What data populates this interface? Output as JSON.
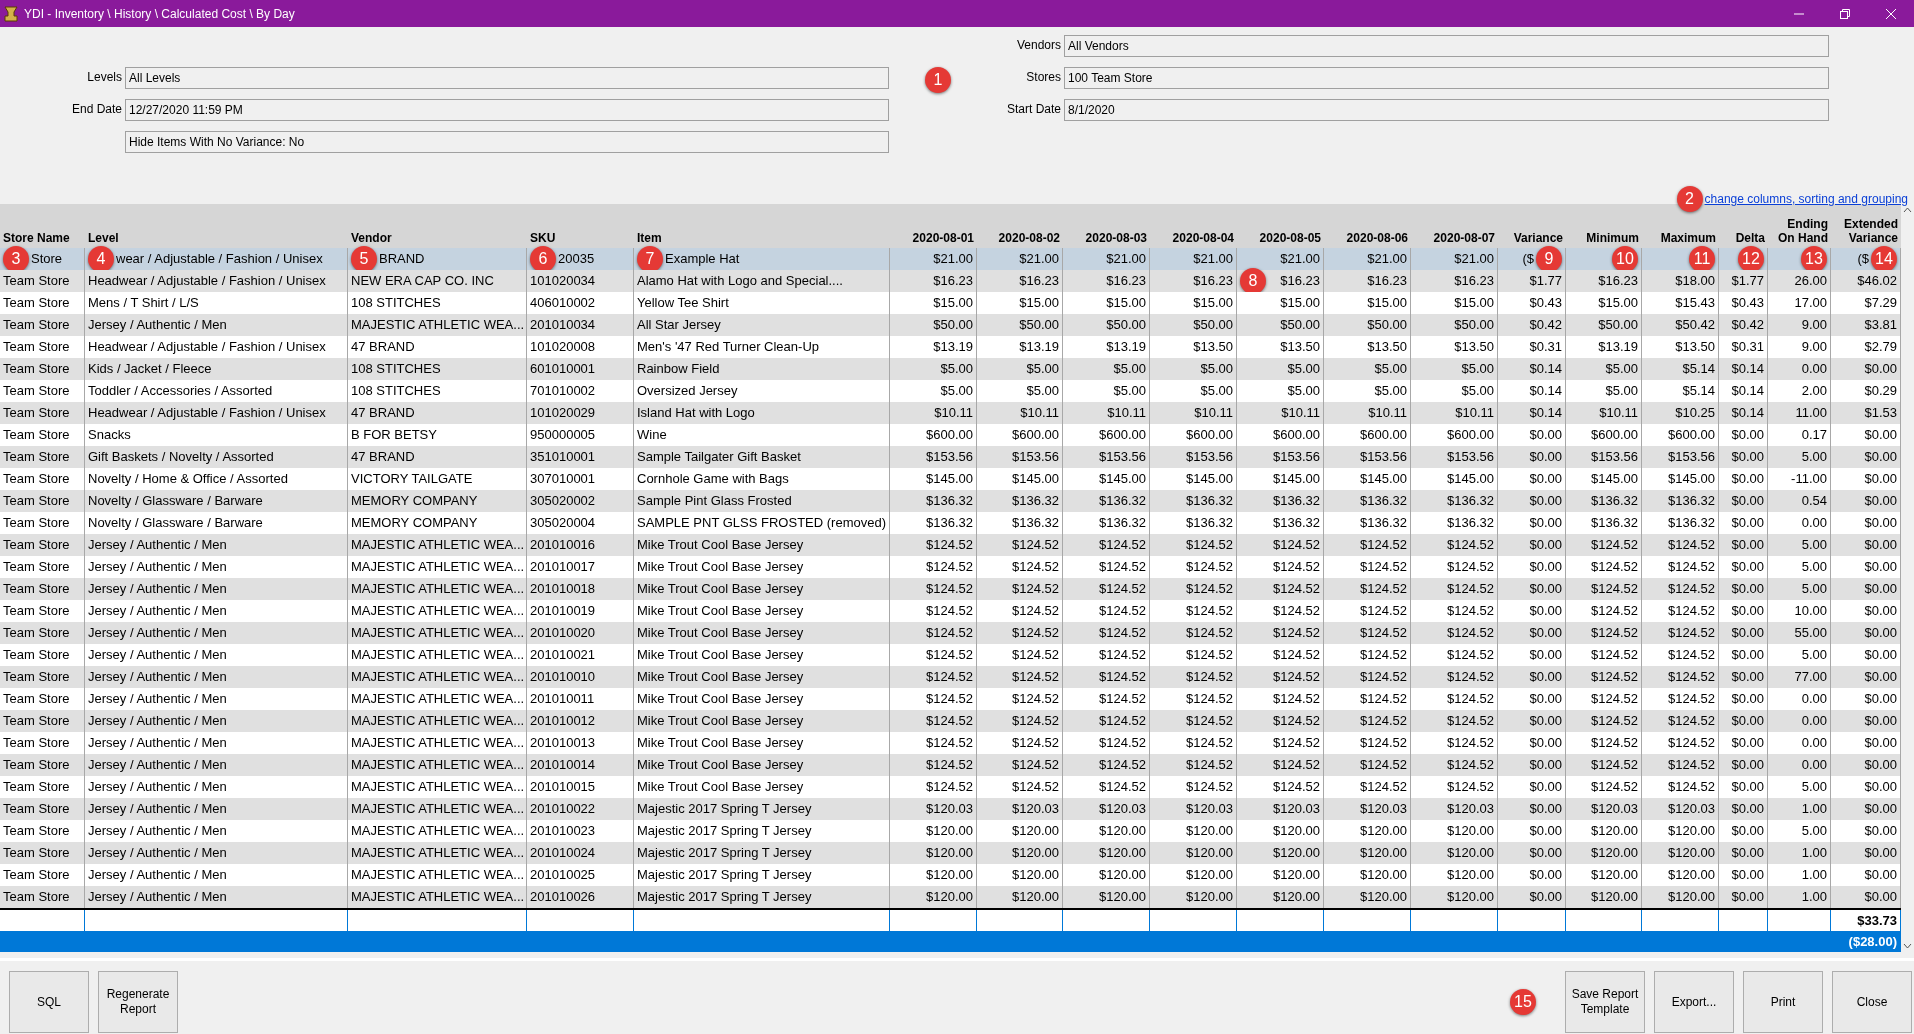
{
  "window": {
    "title": "YDI - Inventory \\ History \\ Calculated Cost \\ By Day"
  },
  "filters_callout": "1",
  "filters": {
    "left": [
      {
        "label": "Levels",
        "value": "All Levels"
      },
      {
        "label": "End Date",
        "value": "12/27/2020 11:59 PM"
      },
      {
        "value": "Hide Items With No Variance: No"
      }
    ],
    "right": [
      {
        "label": "Vendors",
        "value": "All Vendors"
      },
      {
        "label": "Stores",
        "value": "100 Team Store"
      },
      {
        "label": "Start Date",
        "value": "8/1/2020"
      }
    ]
  },
  "columns_link": {
    "text": "change columns, sorting and grouping",
    "callout": "2"
  },
  "table": {
    "columns": [
      "Store Name",
      "Level",
      "Vendor",
      "SKU",
      "Item",
      "2020-08-01",
      "2020-08-02",
      "2020-08-03",
      "2020-08-04",
      "2020-08-05",
      "2020-08-06",
      "2020-08-07",
      "Variance",
      "Minimum",
      "Maximum",
      "Delta",
      "Ending On Hand",
      "Extended Variance"
    ],
    "rows": [
      {
        "selected": true,
        "cells": [
          {
            "text": "Store",
            "callout": "3"
          },
          {
            "text": "wear / Adjustable / Fashion / Unisex",
            "callout": "4"
          },
          {
            "text": "BRAND",
            "callout": "5"
          },
          {
            "text": "20035",
            "callout": "6"
          },
          {
            "text": "Example Hat",
            "callout": "7"
          },
          "$21.00",
          "$21.00",
          "$21.00",
          "$21.00",
          "$21.00",
          "$21.00",
          "$21.00",
          {
            "text": "($",
            "callout": "9"
          },
          {
            "callout": "10"
          },
          {
            "callout": "11"
          },
          {
            "callout": "12"
          },
          {
            "callout": "13"
          },
          {
            "text": "($",
            "callout": "14"
          }
        ]
      },
      {
        "selected": false,
        "cells": [
          "Team Store",
          "Headwear / Adjustable / Fashion / Unisex",
          "NEW ERA CAP CO. INC",
          "101020034",
          "Alamo Hat with Logo and Special....",
          "$16.23",
          "$16.23",
          "$16.23",
          "$16.23",
          {
            "text": "$16.23",
            "callout": "8"
          },
          "$16.23",
          "$16.23",
          "$1.77",
          "$16.23",
          "$18.00",
          "$1.77",
          "26.00",
          "$46.02"
        ]
      },
      {
        "selected": false,
        "cells": [
          "Team Store",
          "Mens / T Shirt / L/S",
          "108 STITCHES",
          "406010002",
          "Yellow Tee Shirt",
          "$15.00",
          "$15.00",
          "$15.00",
          "$15.00",
          "$15.00",
          "$15.00",
          "$15.00",
          "$0.43",
          "$15.00",
          "$15.43",
          "$0.43",
          "17.00",
          "$7.29"
        ]
      },
      {
        "selected": false,
        "cells": [
          "Team Store",
          "Jersey / Authentic / Men",
          "MAJESTIC ATHLETIC WEA...",
          "201010034",
          "All Star Jersey",
          "$50.00",
          "$50.00",
          "$50.00",
          "$50.00",
          "$50.00",
          "$50.00",
          "$50.00",
          "$0.42",
          "$50.00",
          "$50.42",
          "$0.42",
          "9.00",
          "$3.81"
        ]
      },
      {
        "selected": false,
        "cells": [
          "Team Store",
          "Headwear / Adjustable / Fashion / Unisex",
          "47 BRAND",
          "101020008",
          "Men's '47 Red Turner Clean-Up",
          "$13.19",
          "$13.19",
          "$13.19",
          "$13.50",
          "$13.50",
          "$13.50",
          "$13.50",
          "$0.31",
          "$13.19",
          "$13.50",
          "$0.31",
          "9.00",
          "$2.79"
        ]
      },
      {
        "selected": false,
        "cells": [
          "Team Store",
          "Kids / Jacket / Fleece",
          "108 STITCHES",
          "601010001",
          "Rainbow Field",
          "$5.00",
          "$5.00",
          "$5.00",
          "$5.00",
          "$5.00",
          "$5.00",
          "$5.00",
          "$0.14",
          "$5.00",
          "$5.14",
          "$0.14",
          "0.00",
          "$0.00"
        ]
      },
      {
        "selected": false,
        "cells": [
          "Team Store",
          "Toddler / Accessories / Assorted",
          "108 STITCHES",
          "701010002",
          "Oversized Jersey",
          "$5.00",
          "$5.00",
          "$5.00",
          "$5.00",
          "$5.00",
          "$5.00",
          "$5.00",
          "$0.14",
          "$5.00",
          "$5.14",
          "$0.14",
          "2.00",
          "$0.29"
        ]
      },
      {
        "selected": false,
        "cells": [
          "Team Store",
          "Headwear / Adjustable / Fashion / Unisex",
          "47 BRAND",
          "101020029",
          "Island Hat with Logo",
          "$10.11",
          "$10.11",
          "$10.11",
          "$10.11",
          "$10.11",
          "$10.11",
          "$10.11",
          "$0.14",
          "$10.11",
          "$10.25",
          "$0.14",
          "11.00",
          "$1.53"
        ]
      },
      {
        "selected": false,
        "cells": [
          "Team Store",
          "Snacks",
          "B FOR BETSY",
          "950000005",
          "Wine",
          "$600.00",
          "$600.00",
          "$600.00",
          "$600.00",
          "$600.00",
          "$600.00",
          "$600.00",
          "$0.00",
          "$600.00",
          "$600.00",
          "$0.00",
          "0.17",
          "$0.00"
        ]
      },
      {
        "selected": false,
        "cells": [
          "Team Store",
          "Gift Baskets / Novelty / Assorted",
          "47 BRAND",
          "351010001",
          "Sample Tailgater Gift Basket",
          "$153.56",
          "$153.56",
          "$153.56",
          "$153.56",
          "$153.56",
          "$153.56",
          "$153.56",
          "$0.00",
          "$153.56",
          "$153.56",
          "$0.00",
          "5.00",
          "$0.00"
        ]
      },
      {
        "selected": false,
        "cells": [
          "Team Store",
          "Novelty / Home & Office / Assorted",
          "VICTORY TAILGATE",
          "307010001",
          "Cornhole Game with Bags",
          "$145.00",
          "$145.00",
          "$145.00",
          "$145.00",
          "$145.00",
          "$145.00",
          "$145.00",
          "$0.00",
          "$145.00",
          "$145.00",
          "$0.00",
          "-11.00",
          "$0.00"
        ]
      },
      {
        "selected": false,
        "cells": [
          "Team Store",
          "Novelty / Glassware / Barware",
          "MEMORY COMPANY",
          "305020002",
          "Sample Pint Glass Frosted",
          "$136.32",
          "$136.32",
          "$136.32",
          "$136.32",
          "$136.32",
          "$136.32",
          "$136.32",
          "$0.00",
          "$136.32",
          "$136.32",
          "$0.00",
          "0.54",
          "$0.00"
        ]
      },
      {
        "selected": false,
        "cells": [
          "Team Store",
          "Novelty / Glassware / Barware",
          "MEMORY COMPANY",
          "305020004",
          "SAMPLE PNT GLSS FROSTED (removed)",
          "$136.32",
          "$136.32",
          "$136.32",
          "$136.32",
          "$136.32",
          "$136.32",
          "$136.32",
          "$0.00",
          "$136.32",
          "$136.32",
          "$0.00",
          "0.00",
          "$0.00"
        ]
      },
      {
        "selected": false,
        "cells": [
          "Team Store",
          "Jersey / Authentic / Men",
          "MAJESTIC ATHLETIC WEA...",
          "201010016",
          "Mike Trout Cool Base Jersey",
          "$124.52",
          "$124.52",
          "$124.52",
          "$124.52",
          "$124.52",
          "$124.52",
          "$124.52",
          "$0.00",
          "$124.52",
          "$124.52",
          "$0.00",
          "5.00",
          "$0.00"
        ]
      },
      {
        "selected": false,
        "cells": [
          "Team Store",
          "Jersey / Authentic / Men",
          "MAJESTIC ATHLETIC WEA...",
          "201010017",
          "Mike Trout Cool Base Jersey",
          "$124.52",
          "$124.52",
          "$124.52",
          "$124.52",
          "$124.52",
          "$124.52",
          "$124.52",
          "$0.00",
          "$124.52",
          "$124.52",
          "$0.00",
          "5.00",
          "$0.00"
        ]
      },
      {
        "selected": false,
        "cells": [
          "Team Store",
          "Jersey / Authentic / Men",
          "MAJESTIC ATHLETIC WEA...",
          "201010018",
          "Mike Trout Cool Base Jersey",
          "$124.52",
          "$124.52",
          "$124.52",
          "$124.52",
          "$124.52",
          "$124.52",
          "$124.52",
          "$0.00",
          "$124.52",
          "$124.52",
          "$0.00",
          "5.00",
          "$0.00"
        ]
      },
      {
        "selected": false,
        "cells": [
          "Team Store",
          "Jersey / Authentic / Men",
          "MAJESTIC ATHLETIC WEA...",
          "201010019",
          "Mike Trout Cool Base Jersey",
          "$124.52",
          "$124.52",
          "$124.52",
          "$124.52",
          "$124.52",
          "$124.52",
          "$124.52",
          "$0.00",
          "$124.52",
          "$124.52",
          "$0.00",
          "10.00",
          "$0.00"
        ]
      },
      {
        "selected": false,
        "cells": [
          "Team Store",
          "Jersey / Authentic / Men",
          "MAJESTIC ATHLETIC WEA...",
          "201010020",
          "Mike Trout Cool Base Jersey",
          "$124.52",
          "$124.52",
          "$124.52",
          "$124.52",
          "$124.52",
          "$124.52",
          "$124.52",
          "$0.00",
          "$124.52",
          "$124.52",
          "$0.00",
          "55.00",
          "$0.00"
        ]
      },
      {
        "selected": false,
        "cells": [
          "Team Store",
          "Jersey / Authentic / Men",
          "MAJESTIC ATHLETIC WEA...",
          "201010021",
          "Mike Trout Cool Base Jersey",
          "$124.52",
          "$124.52",
          "$124.52",
          "$124.52",
          "$124.52",
          "$124.52",
          "$124.52",
          "$0.00",
          "$124.52",
          "$124.52",
          "$0.00",
          "5.00",
          "$0.00"
        ]
      },
      {
        "selected": false,
        "cells": [
          "Team Store",
          "Jersey / Authentic / Men",
          "MAJESTIC ATHLETIC WEA...",
          "201010010",
          "Mike Trout Cool Base Jersey",
          "$124.52",
          "$124.52",
          "$124.52",
          "$124.52",
          "$124.52",
          "$124.52",
          "$124.52",
          "$0.00",
          "$124.52",
          "$124.52",
          "$0.00",
          "77.00",
          "$0.00"
        ]
      },
      {
        "selected": false,
        "cells": [
          "Team Store",
          "Jersey / Authentic / Men",
          "MAJESTIC ATHLETIC WEA...",
          "201010011",
          "Mike Trout Cool Base Jersey",
          "$124.52",
          "$124.52",
          "$124.52",
          "$124.52",
          "$124.52",
          "$124.52",
          "$124.52",
          "$0.00",
          "$124.52",
          "$124.52",
          "$0.00",
          "0.00",
          "$0.00"
        ]
      },
      {
        "selected": false,
        "cells": [
          "Team Store",
          "Jersey / Authentic / Men",
          "MAJESTIC ATHLETIC WEA...",
          "201010012",
          "Mike Trout Cool Base Jersey",
          "$124.52",
          "$124.52",
          "$124.52",
          "$124.52",
          "$124.52",
          "$124.52",
          "$124.52",
          "$0.00",
          "$124.52",
          "$124.52",
          "$0.00",
          "0.00",
          "$0.00"
        ]
      },
      {
        "selected": false,
        "cells": [
          "Team Store",
          "Jersey / Authentic / Men",
          "MAJESTIC ATHLETIC WEA...",
          "201010013",
          "Mike Trout Cool Base Jersey",
          "$124.52",
          "$124.52",
          "$124.52",
          "$124.52",
          "$124.52",
          "$124.52",
          "$124.52",
          "$0.00",
          "$124.52",
          "$124.52",
          "$0.00",
          "0.00",
          "$0.00"
        ]
      },
      {
        "selected": false,
        "cells": [
          "Team Store",
          "Jersey / Authentic / Men",
          "MAJESTIC ATHLETIC WEA...",
          "201010014",
          "Mike Trout Cool Base Jersey",
          "$124.52",
          "$124.52",
          "$124.52",
          "$124.52",
          "$124.52",
          "$124.52",
          "$124.52",
          "$0.00",
          "$124.52",
          "$124.52",
          "$0.00",
          "0.00",
          "$0.00"
        ]
      },
      {
        "selected": false,
        "cells": [
          "Team Store",
          "Jersey / Authentic / Men",
          "MAJESTIC ATHLETIC WEA...",
          "201010015",
          "Mike Trout Cool Base Jersey",
          "$124.52",
          "$124.52",
          "$124.52",
          "$124.52",
          "$124.52",
          "$124.52",
          "$124.52",
          "$0.00",
          "$124.52",
          "$124.52",
          "$0.00",
          "5.00",
          "$0.00"
        ]
      },
      {
        "selected": false,
        "cells": [
          "Team Store",
          "Jersey / Authentic / Men",
          "MAJESTIC ATHLETIC WEA...",
          "201010022",
          "Majestic 2017 Spring T Jersey",
          "$120.03",
          "$120.03",
          "$120.03",
          "$120.03",
          "$120.03",
          "$120.03",
          "$120.03",
          "$0.00",
          "$120.03",
          "$120.03",
          "$0.00",
          "1.00",
          "$0.00"
        ]
      },
      {
        "selected": false,
        "cells": [
          "Team Store",
          "Jersey / Authentic / Men",
          "MAJESTIC ATHLETIC WEA...",
          "201010023",
          "Majestic 2017 Spring T Jersey",
          "$120.00",
          "$120.00",
          "$120.00",
          "$120.00",
          "$120.00",
          "$120.00",
          "$120.00",
          "$0.00",
          "$120.00",
          "$120.00",
          "$0.00",
          "5.00",
          "$0.00"
        ]
      },
      {
        "selected": false,
        "cells": [
          "Team Store",
          "Jersey / Authentic / Men",
          "MAJESTIC ATHLETIC WEA...",
          "201010024",
          "Majestic 2017 Spring T Jersey",
          "$120.00",
          "$120.00",
          "$120.00",
          "$120.00",
          "$120.00",
          "$120.00",
          "$120.00",
          "$0.00",
          "$120.00",
          "$120.00",
          "$0.00",
          "1.00",
          "$0.00"
        ]
      },
      {
        "selected": false,
        "cells": [
          "Team Store",
          "Jersey / Authentic / Men",
          "MAJESTIC ATHLETIC WEA...",
          "201010025",
          "Majestic 2017 Spring T Jersey",
          "$120.00",
          "$120.00",
          "$120.00",
          "$120.00",
          "$120.00",
          "$120.00",
          "$120.00",
          "$0.00",
          "$120.00",
          "$120.00",
          "$0.00",
          "1.00",
          "$0.00"
        ]
      },
      {
        "selected": false,
        "cells": [
          "Team Store",
          "Jersey / Authentic / Men",
          "MAJESTIC ATHLETIC WEA...",
          "201010026",
          "Majestic 2017 Spring T Jersey",
          "$120.00",
          "$120.00",
          "$120.00",
          "$120.00",
          "$120.00",
          "$120.00",
          "$120.00",
          "$0.00",
          "$120.00",
          "$120.00",
          "$0.00",
          "1.00",
          "$0.00"
        ]
      }
    ],
    "totals": [
      {
        "kind": "plain",
        "value": "$33.73"
      },
      {
        "kind": "highlight",
        "value": "($28.00)"
      }
    ]
  },
  "buttons_left": [
    "SQL",
    "Regenerate Report"
  ],
  "buttons_callout": "15",
  "buttons_right": [
    "Save Report Template",
    "Export...",
    "Print",
    "Close"
  ]
}
